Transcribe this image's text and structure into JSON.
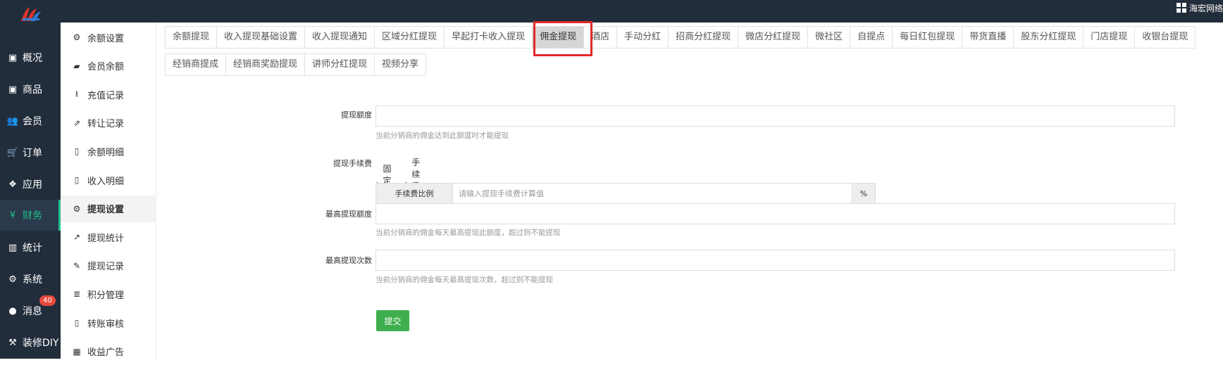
{
  "topbar": {
    "user_name": "海宏网络"
  },
  "left_nav": [
    {
      "label": "概况",
      "icon": "dashboard-icon"
    },
    {
      "label": "商品",
      "icon": "box-icon"
    },
    {
      "label": "会员",
      "icon": "users-icon"
    },
    {
      "label": "订单",
      "icon": "cart-icon"
    },
    {
      "label": "应用",
      "icon": "cubes-icon"
    },
    {
      "label": "财务",
      "icon": "yen-icon"
    },
    {
      "label": "统计",
      "icon": "bar-chart-icon"
    },
    {
      "label": "系统",
      "icon": "cogs-icon"
    },
    {
      "label": "消息",
      "icon": "comment-icon",
      "badge": "40"
    },
    {
      "label": "装修DIY",
      "icon": "gavel-icon"
    }
  ],
  "sub_nav": [
    {
      "label": "余额设置",
      "icon": "gear-icon"
    },
    {
      "label": "会员余额",
      "icon": "book-icon"
    },
    {
      "label": "充值记录",
      "icon": "download-icon"
    },
    {
      "label": "转让记录",
      "icon": "external-link-icon"
    },
    {
      "label": "余额明细",
      "icon": "file-icon"
    },
    {
      "label": "收入明细",
      "icon": "file-icon"
    },
    {
      "label": "提现设置",
      "icon": "gear-icon"
    },
    {
      "label": "提现统计",
      "icon": "line-chart-icon"
    },
    {
      "label": "提现记录",
      "icon": "pencil-icon"
    },
    {
      "label": "积分管理",
      "icon": "database-icon"
    },
    {
      "label": "转账审核",
      "icon": "file-icon"
    },
    {
      "label": "收益广告",
      "icon": "image-icon"
    }
  ],
  "tabs_row1": [
    "余额提现",
    "收入提现基础设置",
    "收入提现通知",
    "区域分红提现",
    "早起打卡收入提现",
    "佣金提现",
    "酒店",
    "手动分红",
    "招商分红提现",
    "微店分红提现",
    "微社区",
    "自提点",
    "每日红包提现",
    "带货直播",
    "股东分红提现",
    "门店提现",
    "收银台提现"
  ],
  "tabs_row2": [
    "经销商提成",
    "经销商奖励提现",
    "讲师分红提现",
    "视频分享"
  ],
  "active_tab": "佣金提现",
  "form": {
    "amount_label": "提现额度",
    "amount_value": "",
    "amount_help": "当前分销商的佣金达到此额度时才能提现",
    "fee_label": "提现手续费",
    "fee_option_fixed": "固定金额",
    "fee_option_ratio": "手续费比例",
    "fee_selected": "ratio",
    "fee_addon_left": "手续费比例",
    "fee_placeholder": "请输入提现手续费计算值",
    "fee_addon_right": "%",
    "max_amount_label": "最高提现额度",
    "max_amount_value": "",
    "max_amount_help": "当前分销商的佣金每天最高提现此额度，超过则不能提现",
    "max_times_label": "最高提现次数",
    "max_times_value": "",
    "max_times_help": "当前分销商的佣金每天最高提现次数，超过则不能提现",
    "submit_label": "提交"
  },
  "colors": {
    "sidebar_bg": "#222d3c",
    "accent_green": "#1fc08a",
    "submit_green": "#3fae4f",
    "highlight_red": "#e22a2a",
    "badge_red": "#e8493e"
  }
}
